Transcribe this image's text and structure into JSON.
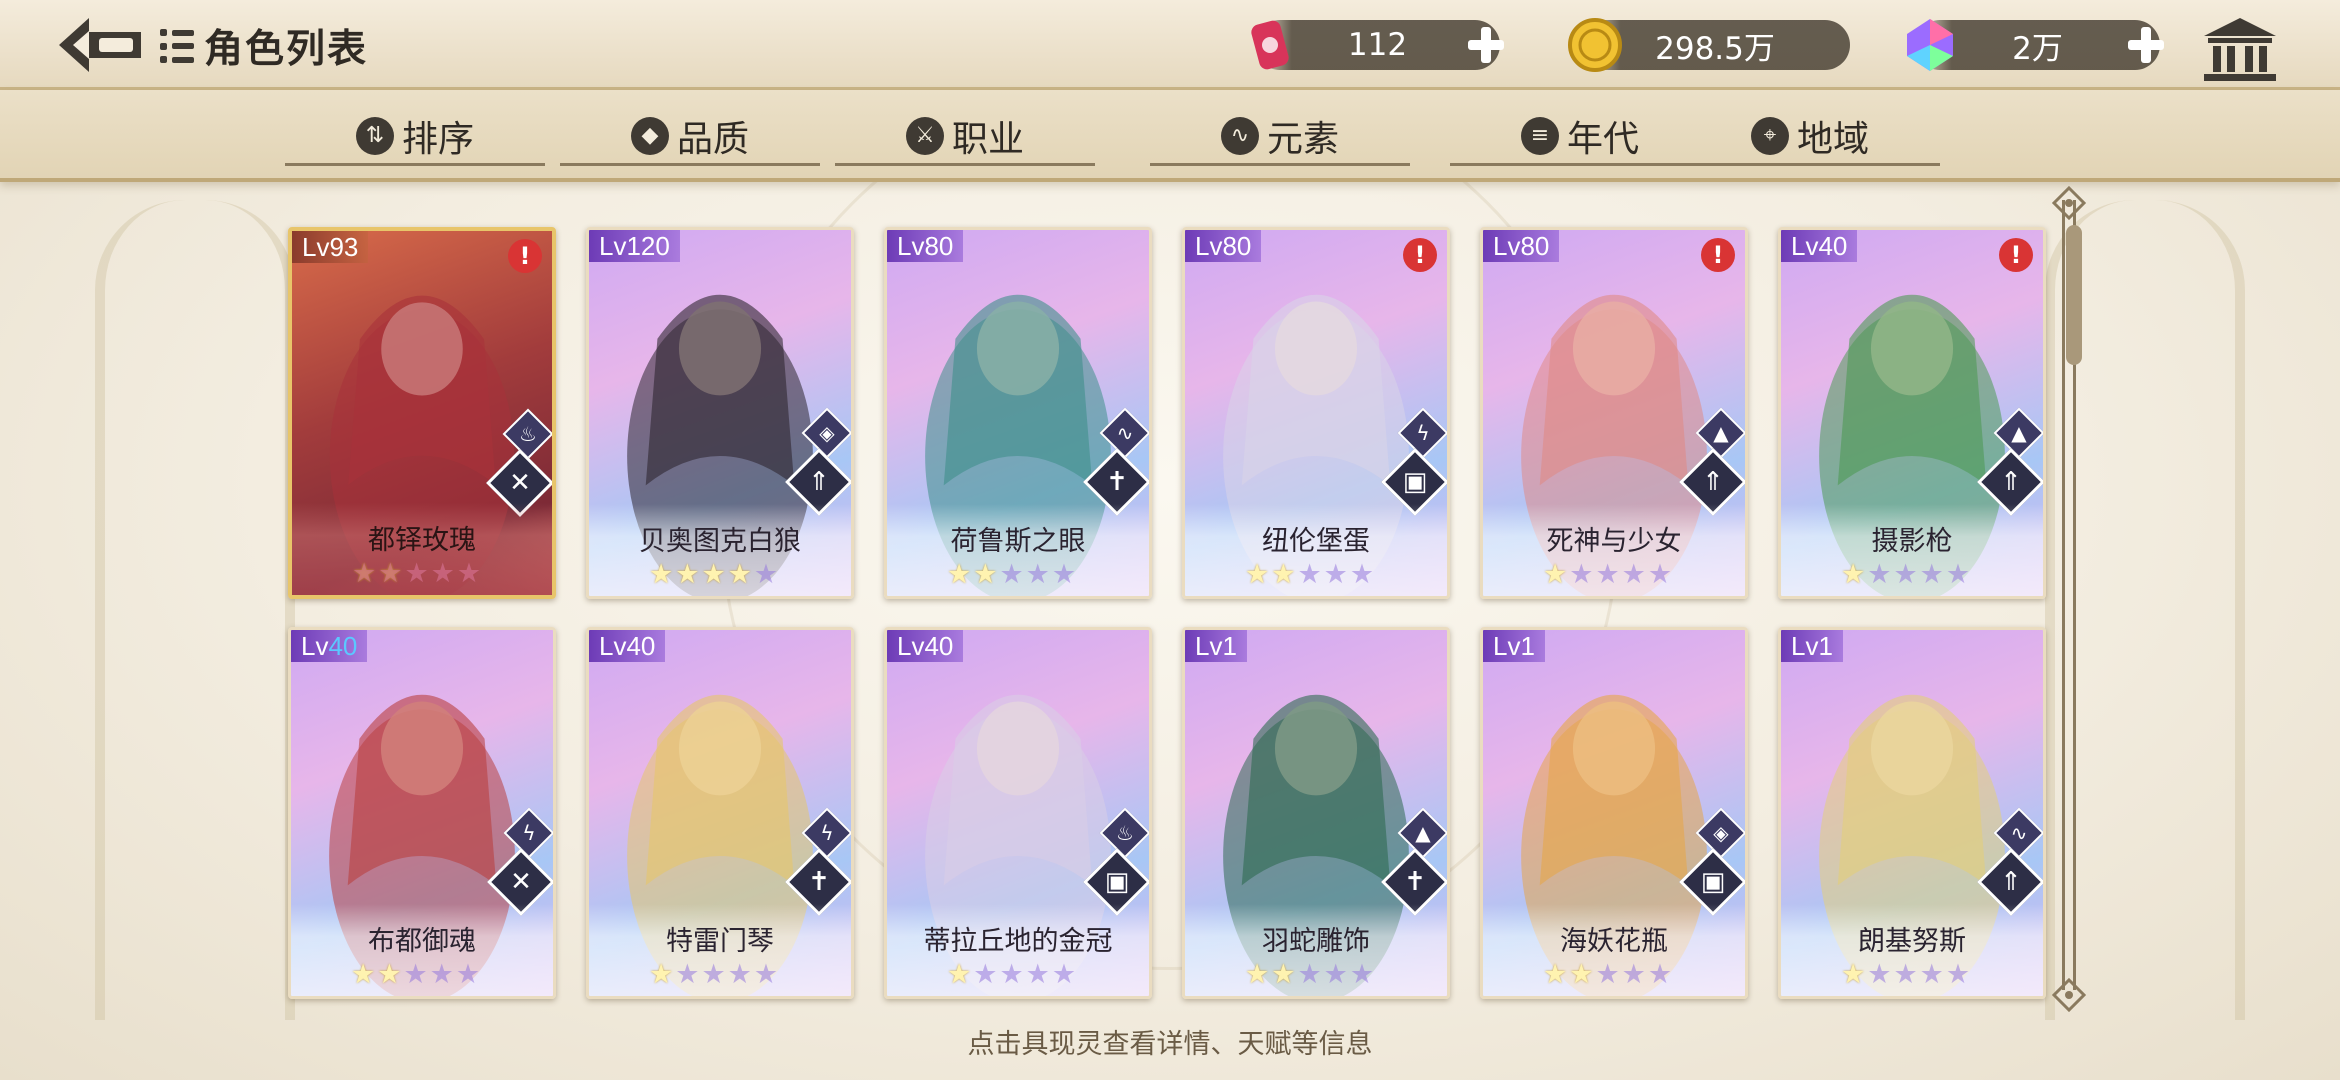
{
  "header": {
    "title": "角色列表",
    "currencies": [
      {
        "name": "tickets",
        "amount": "112",
        "color": "#d8345a"
      },
      {
        "name": "gold",
        "amount": "298.5万",
        "color": "#f1c232"
      },
      {
        "name": "gems",
        "amount": "2万",
        "color": "#9b6cff"
      }
    ]
  },
  "filters": [
    {
      "label": "排序",
      "icon": "sort-icon"
    },
    {
      "label": "品质",
      "icon": "quality-icon"
    },
    {
      "label": "职业",
      "icon": "profession-icon"
    },
    {
      "label": "元素",
      "icon": "element-icon"
    },
    {
      "label": "年代",
      "icon": "era-icon"
    },
    {
      "label": "地域",
      "icon": "region-icon"
    }
  ],
  "cards": [
    {
      "lv_prefix": "Lv",
      "lv": "93",
      "name": "都铎玫瑰",
      "stars": 2,
      "alert": "!",
      "element": "fire",
      "job": "dual-swords",
      "gold": true,
      "portrait": "#a8323a"
    },
    {
      "lv_prefix": "Lv",
      "lv": "120",
      "name": "贝奥图克白狼",
      "stars": 4,
      "alert": "",
      "element": "water",
      "job": "spear",
      "gold": false,
      "portrait": "#2e2630"
    },
    {
      "lv_prefix": "Lv",
      "lv": "80",
      "name": "荷鲁斯之眼",
      "stars": 2,
      "alert": "",
      "element": "wind",
      "job": "cross",
      "gold": false,
      "portrait": "#3f8f8a"
    },
    {
      "lv_prefix": "Lv",
      "lv": "80",
      "name": "纽伦堡蛋",
      "stars": 2,
      "alert": "!",
      "element": "thunder",
      "job": "book",
      "gold": false,
      "portrait": "#d9d4e8"
    },
    {
      "lv_prefix": "Lv",
      "lv": "80",
      "name": "死神与少女",
      "stars": 1,
      "alert": "!",
      "element": "earth",
      "job": "spear",
      "gold": false,
      "portrait": "#e08a86"
    },
    {
      "lv_prefix": "Lv",
      "lv": "40",
      "name": "摄影枪",
      "stars": 1,
      "alert": "!",
      "element": "earth",
      "job": "spear",
      "gold": false,
      "portrait": "#4f9a55"
    },
    {
      "lv_prefix": "Lv",
      "lv": "40",
      "name": "布都御魂",
      "stars": 2,
      "alert": "",
      "element": "thunder",
      "job": "dual-swords",
      "gold": false,
      "portrait": "#b94040",
      "lv_blue": true
    },
    {
      "lv_prefix": "Lv",
      "lv": "40",
      "name": "特雷门琴",
      "stars": 1,
      "alert": "",
      "element": "thunder",
      "job": "cross",
      "gold": false,
      "portrait": "#e6c66a"
    },
    {
      "lv_prefix": "Lv",
      "lv": "40",
      "name": "蒂拉丘地的金冠",
      "stars": 1,
      "alert": "",
      "element": "fire",
      "job": "book",
      "gold": false,
      "portrait": "#d8cde6"
    },
    {
      "lv_prefix": "Lv",
      "lv": "1",
      "name": "羽蛇雕饰",
      "stars": 2,
      "alert": "",
      "element": "earth",
      "job": "cross",
      "gold": false,
      "portrait": "#2f6a52"
    },
    {
      "lv_prefix": "Lv",
      "lv": "1",
      "name": "海妖花瓶",
      "stars": 2,
      "alert": "",
      "element": "water",
      "job": "book",
      "gold": false,
      "portrait": "#e6a64a"
    },
    {
      "lv_prefix": "Lv",
      "lv": "1",
      "name": "朗基努斯",
      "stars": 1,
      "alert": "",
      "element": "wind",
      "job": "spear",
      "gold": false,
      "portrait": "#e3cf7a"
    }
  ],
  "footer": {
    "hint": "点击具现灵查看详情、天赋等信息"
  }
}
